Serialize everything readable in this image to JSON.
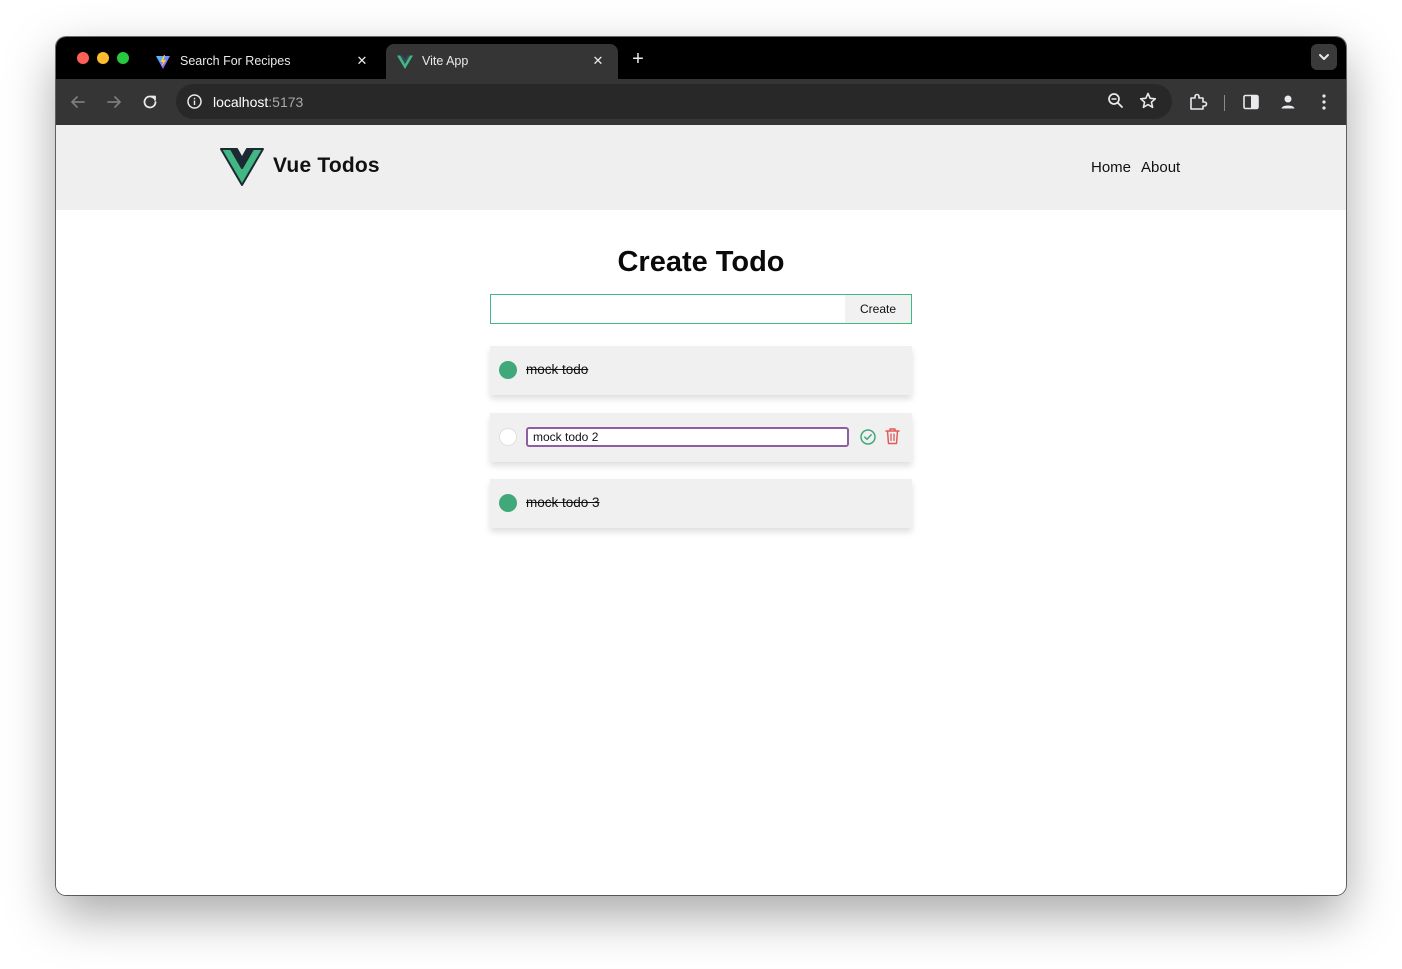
{
  "browser": {
    "tabs": [
      {
        "title": "Search For Recipes",
        "favicon": "vite-favicon",
        "active": false
      },
      {
        "title": "Vite App",
        "favicon": "vue-favicon",
        "active": true
      }
    ],
    "tab_close_glyph": "✕",
    "new_tab_glyph": "+",
    "url_host": "localhost",
    "url_port": ":5173"
  },
  "site": {
    "title": "Vue Todos",
    "nav": {
      "home": "Home",
      "about": "About"
    }
  },
  "main": {
    "heading": "Create Todo",
    "create_input_value": "",
    "create_button": "Create",
    "todos": [
      {
        "text": "mock todo",
        "completed": true,
        "editing": false
      },
      {
        "text": "mock todo 2",
        "completed": false,
        "editing": true
      },
      {
        "text": "mock todo 3",
        "completed": true,
        "editing": false
      }
    ]
  },
  "colors": {
    "accent": "#41b883",
    "complete": "#41a87a",
    "edit_border": "#8d5ea0",
    "delete": "#e05a5a"
  }
}
